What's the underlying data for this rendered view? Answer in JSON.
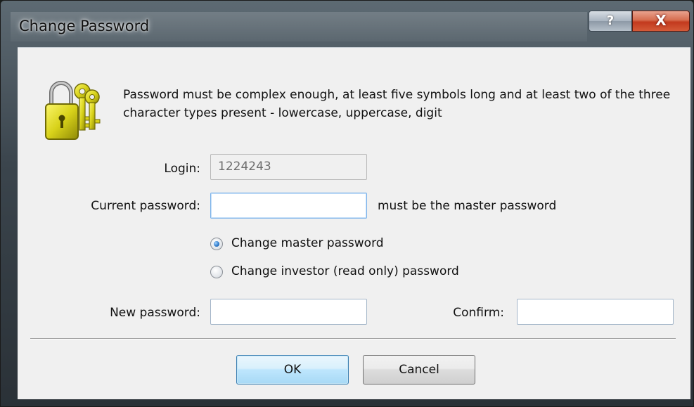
{
  "window": {
    "title": "Change Password",
    "help_glyph": "?",
    "close_glyph": "X"
  },
  "info": {
    "message": "Password must be complex enough, at least five symbols long and at least two of the three character types present - lowercase, uppercase, digit",
    "icon": "padlock-keys-icon"
  },
  "form": {
    "login_label": "Login:",
    "login_value": "1224243",
    "current_password_label": "Current password:",
    "current_password_value": "",
    "current_password_hint": "must be the master password",
    "radio_master_label": "Change master password",
    "radio_master_checked": true,
    "radio_investor_label": "Change investor (read only) password",
    "radio_investor_checked": false,
    "new_password_label": "New password:",
    "new_password_value": "",
    "confirm_label": "Confirm:",
    "confirm_value": ""
  },
  "buttons": {
    "ok_label": "OK",
    "cancel_label": "Cancel"
  },
  "colors": {
    "accent": "#3c7fb1",
    "close": "#c2391d",
    "lock_gold": "#d8d21a"
  }
}
